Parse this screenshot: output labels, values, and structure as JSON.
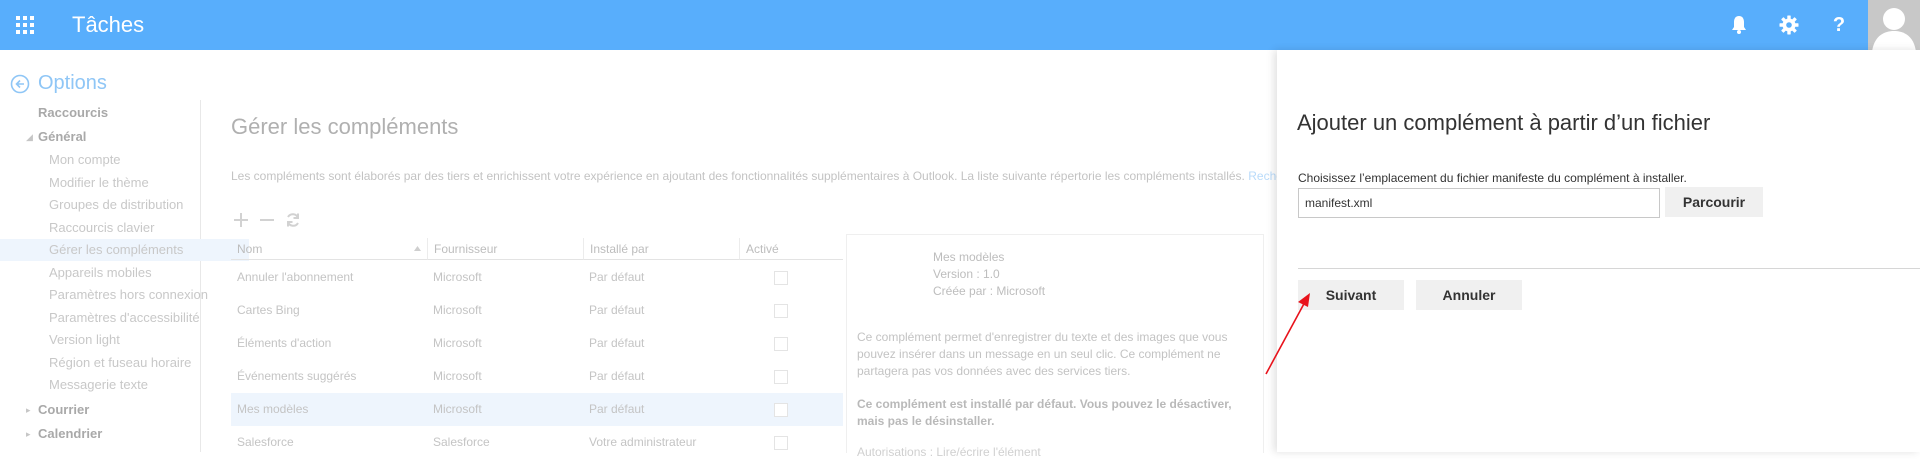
{
  "app": {
    "title": "Tâches"
  },
  "options": {
    "title": "Options"
  },
  "nav": {
    "items": [
      {
        "label": "Raccourcis",
        "level": 1,
        "caret": ""
      },
      {
        "label": "Général",
        "level": 1,
        "caret": "◢"
      },
      {
        "label": "Mon compte",
        "level": 2
      },
      {
        "label": "Modifier le thème",
        "level": 2
      },
      {
        "label": "Groupes de distribution",
        "level": 2
      },
      {
        "label": "Raccourcis clavier",
        "level": 2
      },
      {
        "label": "Gérer les compléments",
        "level": 2,
        "selected": true
      },
      {
        "label": "Appareils mobiles",
        "level": 2
      },
      {
        "label": "Paramètres hors connexion",
        "level": 2
      },
      {
        "label": "Paramètres d'accessibilité",
        "level": 2
      },
      {
        "label": "Version light",
        "level": 2
      },
      {
        "label": "Région et fuseau horaire",
        "level": 2
      },
      {
        "label": "Messagerie texte",
        "level": 2
      },
      {
        "label": "Courrier",
        "level": 1,
        "caret": "▸"
      },
      {
        "label": "Calendrier",
        "level": 1,
        "caret": "▸"
      }
    ]
  },
  "page": {
    "title": "Gérer les compléments",
    "description": "Les compléments sont élaborés par des tiers et enrichissent votre expérience en ajoutant des fonctionnalités supplémentaires à Outlook. La liste suivante répertorie les compléments installés.",
    "link": "Recherch"
  },
  "table": {
    "headers": [
      "Nom",
      "Fournisseur",
      "Installé par",
      "Activé"
    ],
    "rows": [
      {
        "name": "Annuler l'abonnement",
        "provider": "Microsoft",
        "installed_by": "Par défaut"
      },
      {
        "name": "Cartes Bing",
        "provider": "Microsoft",
        "installed_by": "Par défaut"
      },
      {
        "name": "Éléments d'action",
        "provider": "Microsoft",
        "installed_by": "Par défaut"
      },
      {
        "name": "Événements suggérés",
        "provider": "Microsoft",
        "installed_by": "Par défaut"
      },
      {
        "name": "Mes modèles",
        "provider": "Microsoft",
        "installed_by": "Par défaut",
        "selected": true
      },
      {
        "name": "Salesforce",
        "provider": "Salesforce",
        "installed_by": "Votre administrateur"
      }
    ]
  },
  "detail": {
    "name": "Mes modèles",
    "version": "Version : 1.0",
    "created_by": "Créée par : Microsoft",
    "description": "Ce complément permet d'enregistrer du texte et des images que vous pouvez insérer dans un message en un seul clic. Ce complément ne partagera pas vos données avec des services tiers.",
    "note": "Ce complément est installé par défaut. Vous pouvez le désactiver, mais pas le désinstaller.",
    "permissions": "Autorisations : Lire/écrire l'élément"
  },
  "panel": {
    "title": "Ajouter un complément à partir d’un fichier",
    "instruction": "Choisissez l’emplacement du fichier manifeste du complément à installer.",
    "file_value": "manifest.xml",
    "browse_label": "Parcourir",
    "next_label": "Suivant",
    "cancel_label": "Annuler"
  },
  "colors": {
    "topbar": "#58aefc",
    "annotation_arrow": "#e8121b"
  },
  "icons": [
    "app-launcher-icon",
    "bell-icon",
    "gear-icon",
    "help-icon",
    "avatar-icon",
    "back-arrow-icon",
    "add-icon",
    "remove-icon",
    "refresh-icon",
    "sort-asc-icon"
  ]
}
